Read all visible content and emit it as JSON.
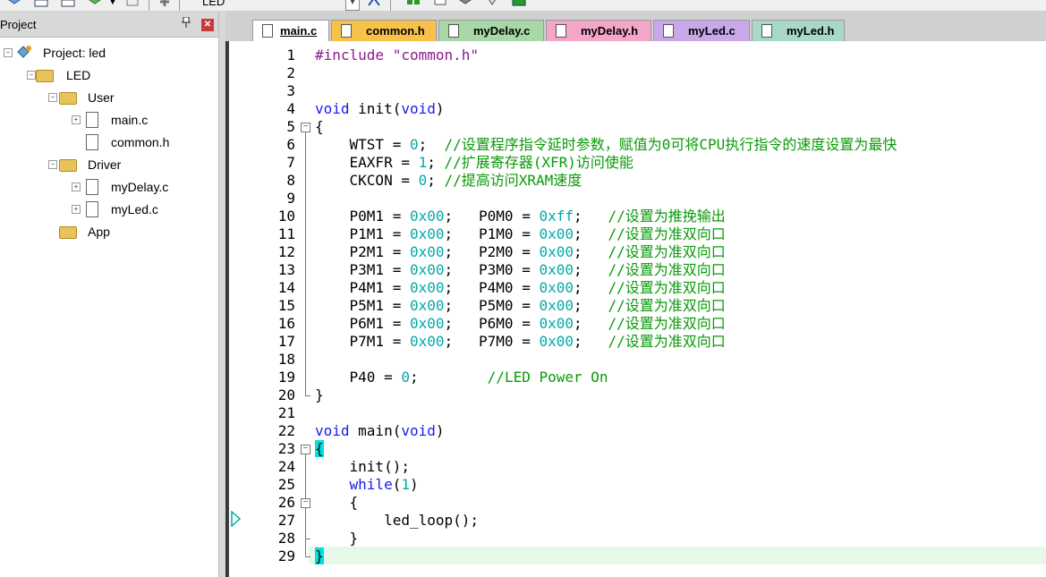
{
  "toolbar": {
    "target_name": "LED",
    "icons": [
      "load-icon",
      "grid-icon",
      "grid-icon",
      "layers-icon",
      "dropdown-icon",
      "options-icon",
      "pin-icon",
      "manage-icon",
      "build-icon",
      "window-icon",
      "checklist-icon",
      "tools-icon",
      "mcu-icon"
    ]
  },
  "project_panel": {
    "title": "Project",
    "tree": [
      {
        "label": "Project: led",
        "level": 0,
        "type": "project",
        "expander": "minus"
      },
      {
        "label": "LED",
        "level": 1,
        "type": "target",
        "expander": "minus"
      },
      {
        "label": "User",
        "level": 2,
        "type": "folder",
        "expander": "minus"
      },
      {
        "label": "main.c",
        "level": 3,
        "type": "file",
        "expander": "plus"
      },
      {
        "label": "common.h",
        "level": 3,
        "type": "file",
        "expander": ""
      },
      {
        "label": "Driver",
        "level": 2,
        "type": "folder",
        "expander": "minus"
      },
      {
        "label": "myDelay.c",
        "level": 3,
        "type": "file",
        "expander": "plus"
      },
      {
        "label": "myLed.c",
        "level": 3,
        "type": "file",
        "expander": "plus"
      },
      {
        "label": "App",
        "level": 2,
        "type": "folder",
        "expander": ""
      }
    ]
  },
  "tabs": [
    {
      "label": "main.c",
      "active": true,
      "color": "#ffffff"
    },
    {
      "label": "common.h",
      "active": false,
      "color": "#f7c24a"
    },
    {
      "label": "myDelay.c",
      "active": false,
      "color": "#a8d8a8"
    },
    {
      "label": "myDelay.h",
      "active": false,
      "color": "#f4a6c8"
    },
    {
      "label": "myLed.c",
      "active": false,
      "color": "#c8a8e8"
    },
    {
      "label": "myLed.h",
      "active": false,
      "color": "#a8d8c8"
    }
  ],
  "editor": {
    "current_line": 29,
    "exec_line": 27,
    "lines": [
      "#include \"common.h\"",
      "",
      "",
      "void init(void)",
      "{",
      "    WTST = 0;  //设置程序指令延时参数，赋值为0可将CPU执行指令的速度设置为最快",
      "    EAXFR = 1; //扩展寄存器(XFR)访问使能",
      "    CKCON = 0; //提高访问XRAM速度",
      "",
      "    P0M1 = 0x00;   P0M0 = 0xff;   //设置为推挽输出",
      "    P1M1 = 0x00;   P1M0 = 0x00;   //设置为准双向口",
      "    P2M1 = 0x00;   P2M0 = 0x00;   //设置为准双向口",
      "    P3M1 = 0x00;   P3M0 = 0x00;   //设置为准双向口",
      "    P4M1 = 0x00;   P4M0 = 0x00;   //设置为准双向口",
      "    P5M1 = 0x00;   P5M0 = 0x00;   //设置为准双向口",
      "    P6M1 = 0x00;   P6M0 = 0x00;   //设置为准双向口",
      "    P7M1 = 0x00;   P7M0 = 0x00;   //设置为准双向口",
      "",
      "    P40 = 0;        //LED Power On",
      "}",
      "",
      "void main(void)",
      "{",
      "    init();",
      "    while(1)",
      "    {",
      "        led_loop();",
      "    }",
      "}"
    ]
  },
  "colors": {
    "keyword": "#1a1aee",
    "number": "#00aaaa",
    "comment": "#0a9a0a",
    "string": "#8a1a8a",
    "current_line": "#e6f9e9",
    "brace_highlight": "#00e0e0"
  }
}
